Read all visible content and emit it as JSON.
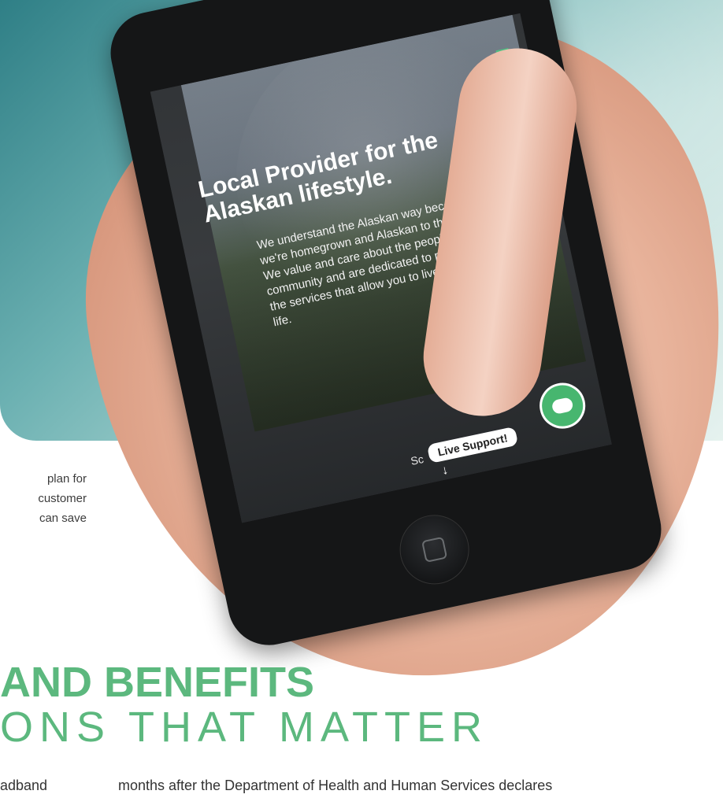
{
  "phone_screen": {
    "headline": "Local Provider for the Alaskan lifestyle.",
    "body": "We understand the Alaskan way because we're homegrown and Alaskan to the core. We value and care about the people in our community and are dedicated to providing the services that allow you to live your best life.",
    "live_support_label": "Live Support!",
    "scroll_label": "Sc",
    "scroll_arrow": "↓"
  },
  "side_text": {
    "lines": [
      "plan for",
      "customer",
      "can save"
    ]
  },
  "section": {
    "heading_line1": "AND BENEFITS",
    "heading_line2": "ONS THAT MATTER"
  },
  "footer_text": {
    "left": "adband",
    "right": "months after the Department of Health and Human Services declares"
  },
  "colors": {
    "accent_green": "#5cb87e",
    "teal_bg": "#6cb1b2",
    "phone_body": "#151617"
  },
  "icons": {
    "chat": "chat-icon",
    "home": "home-button-icon"
  }
}
